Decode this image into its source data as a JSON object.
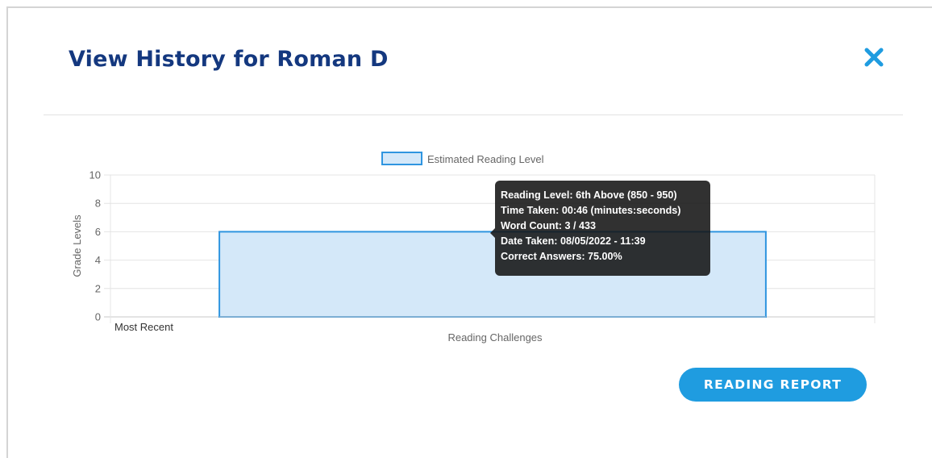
{
  "modal": {
    "title": "View History for Roman D",
    "close_icon": "close-x-icon",
    "report_button_label": "READING REPORT"
  },
  "colors": {
    "title": "#14387f",
    "accent": "#1f9ce0",
    "bar_fill": "#d4e8f9",
    "bar_border": "#2f95e0"
  },
  "chart_data": {
    "type": "bar",
    "categories": [
      "Most Recent"
    ],
    "series": [
      {
        "name": "Estimated Reading Level",
        "values": [
          6
        ]
      }
    ],
    "xlabel": "Reading Challenges",
    "ylabel": "Grade Levels",
    "ylim": [
      0,
      10
    ],
    "yticks": [
      0,
      2,
      4,
      6,
      8,
      10
    ],
    "grid": true,
    "legend": "top"
  },
  "tooltip": {
    "lines": [
      "Reading Level: 6th Above (850 - 950)",
      "Time Taken: 00:46 (minutes:seconds)",
      "Word Count: 3 / 433",
      "Date Taken: 08/05/2022 - 11:39",
      "Correct Answers: 75.00%"
    ]
  }
}
